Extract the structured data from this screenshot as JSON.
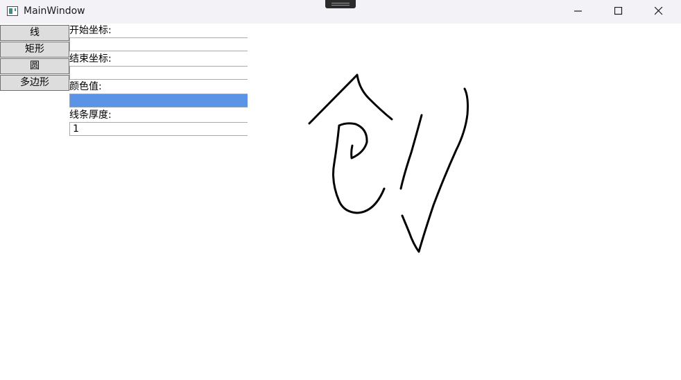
{
  "window": {
    "title": "MainWindow",
    "icon": "app-window-icon",
    "controls": [
      "minimize-icon",
      "maximize-icon",
      "close-icon"
    ]
  },
  "toolbar": {
    "buttons": [
      {
        "label": "线"
      },
      {
        "label": "矩形"
      },
      {
        "label": "圆"
      },
      {
        "label": "多边形"
      }
    ]
  },
  "form": {
    "start_label": "开始坐标:",
    "start_value": "",
    "end_label": "结束坐标:",
    "end_value": "",
    "color_label": "颜色值:",
    "color_value": "#5b94e6",
    "thickness_label": "线条厚度:",
    "thickness_value": "1"
  },
  "canvas": {
    "stroke_color": "#000000"
  }
}
